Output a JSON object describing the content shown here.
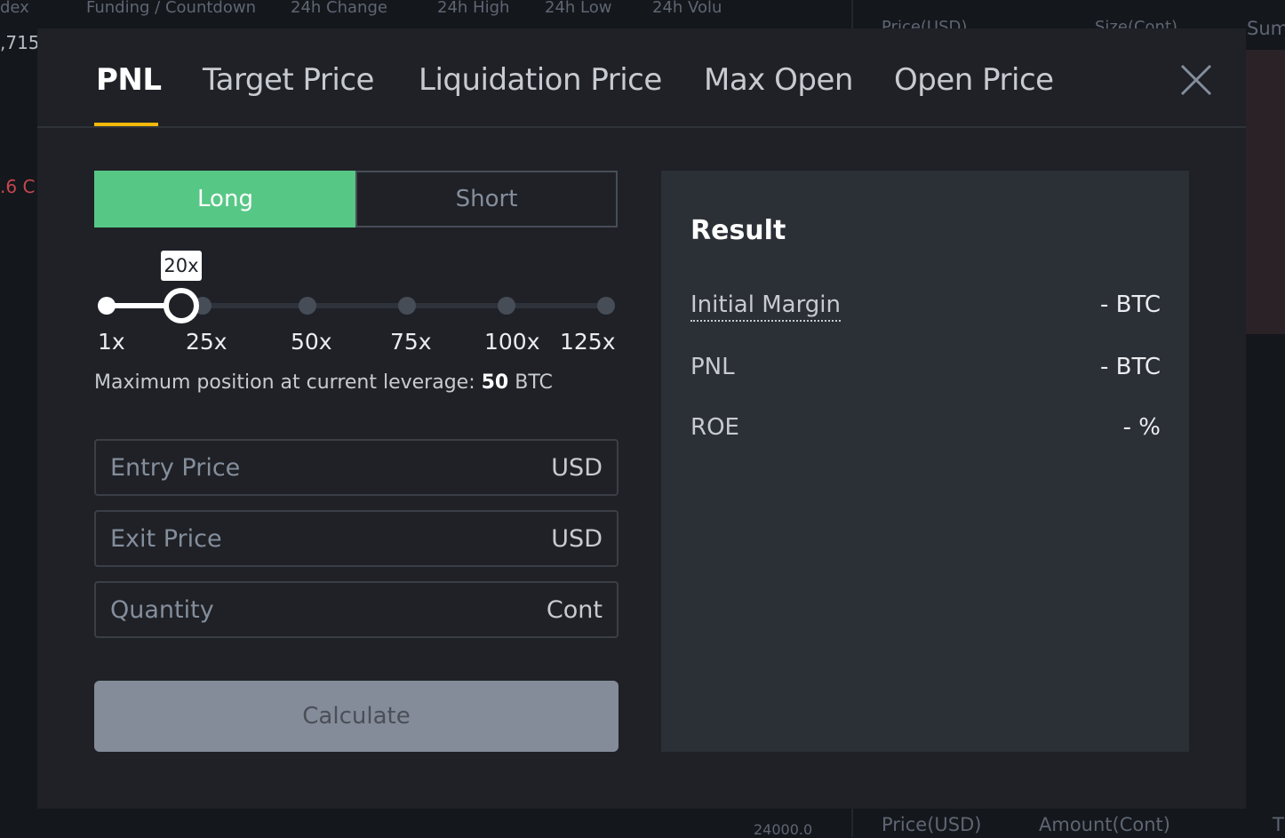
{
  "background": {
    "header": [
      "dex",
      "Funding / Countdown",
      "24h Change",
      "24h High",
      "24h Low",
      "24h Volu"
    ],
    "price_partial": ",715",
    "orderbook_headers": [
      "Price(USD)",
      "Size(Cont)",
      "Sum"
    ],
    "trades_headers": [
      "Price(USD)",
      "Amount(Cont)",
      "T"
    ],
    "axis_label": "24000.0",
    "ticker_partial": ".6 C"
  },
  "modal": {
    "tabs": [
      {
        "label": "PNL",
        "active": true
      },
      {
        "label": "Target Price",
        "active": false
      },
      {
        "label": "Liquidation Price",
        "active": false
      },
      {
        "label": "Max Open",
        "active": false
      },
      {
        "label": "Open Price",
        "active": false
      }
    ],
    "close_icon": "close-icon",
    "side": {
      "long": "Long",
      "short": "Short",
      "selected": "Long"
    },
    "leverage": {
      "value": 20,
      "tooltip": "20x",
      "min": 1,
      "max": 125,
      "marks": [
        "1x",
        "25x",
        "50x",
        "75x",
        "100x",
        "125x"
      ]
    },
    "max_position": {
      "label": "Maximum position at current leverage:",
      "value": "50",
      "unit": "BTC"
    },
    "fields": [
      {
        "placeholder": "Entry Price",
        "unit": "USD",
        "value": ""
      },
      {
        "placeholder": "Exit Price",
        "unit": "USD",
        "value": ""
      },
      {
        "placeholder": "Quantity",
        "unit": "Cont",
        "value": ""
      }
    ],
    "calculate_label": "Calculate",
    "result": {
      "title": "Result",
      "rows": [
        {
          "label": "Initial Margin",
          "value": "- BTC"
        },
        {
          "label": "PNL",
          "value": "- BTC"
        },
        {
          "label": "ROE",
          "value": "- %"
        }
      ]
    },
    "colors": {
      "accent": "#f0b90b",
      "long": "#57c786",
      "panel": "#2b2f36",
      "modal": "#1f2126"
    }
  }
}
